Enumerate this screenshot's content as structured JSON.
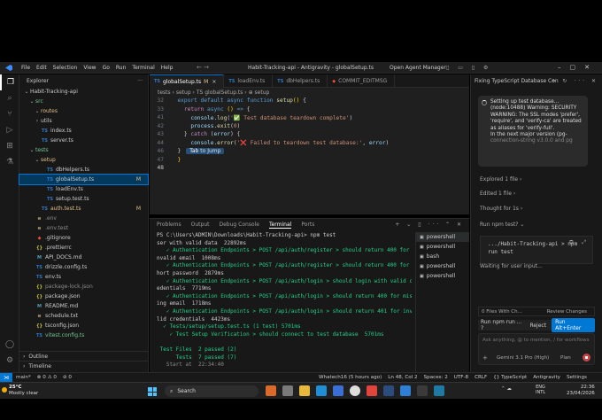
{
  "titlebar": {
    "menus": [
      "File",
      "Edit",
      "Selection",
      "View",
      "Go",
      "Run",
      "Terminal",
      "Help"
    ],
    "window_title": "Habit-Tracking-api - Antigravity - globalSetup.ts",
    "agent_manager": "Open Agent Manager"
  },
  "sidebar": {
    "header": "Explorer",
    "tree": [
      {
        "label": "Habit-Tracking-api",
        "chev": "⌄",
        "indent": 0,
        "icon": "",
        "status": "",
        "style": ""
      },
      {
        "label": "src",
        "chev": "⌄",
        "indent": 1,
        "icon": "",
        "status": "",
        "style": "git"
      },
      {
        "label": "routes",
        "chev": "⌄",
        "indent": 2,
        "icon": "",
        "status": "",
        "style": "mod"
      },
      {
        "label": "utils",
        "chev": "›",
        "indent": 2,
        "icon": "",
        "status": "",
        "style": ""
      },
      {
        "label": "index.ts",
        "chev": "",
        "indent": 2,
        "icon": "TS",
        "status": "",
        "style": ""
      },
      {
        "label": "server.ts",
        "chev": "",
        "indent": 2,
        "icon": "TS",
        "status": "",
        "style": ""
      },
      {
        "label": "tests",
        "chev": "⌄",
        "indent": 1,
        "icon": "",
        "status": "",
        "style": "git"
      },
      {
        "label": "setup",
        "chev": "⌄",
        "indent": 2,
        "icon": "",
        "status": "",
        "style": "mod"
      },
      {
        "label": "dbHelpers.ts",
        "chev": "",
        "indent": 3,
        "icon": "TS",
        "status": "",
        "style": ""
      },
      {
        "label": "globalSetup.ts",
        "chev": "",
        "indent": 3,
        "icon": "TS",
        "status": "M",
        "style": "selected"
      },
      {
        "label": "loadEnv.ts",
        "chev": "",
        "indent": 3,
        "icon": "TS",
        "status": "",
        "style": ""
      },
      {
        "label": "setup.test.ts",
        "chev": "",
        "indent": 3,
        "icon": "TS",
        "status": "",
        "style": ""
      },
      {
        "label": "auth.test.ts",
        "chev": "",
        "indent": 2,
        "icon": "TS",
        "status": "M",
        "style": "mod"
      },
      {
        "label": ".env",
        "chev": "",
        "indent": 1,
        "icon": "≡",
        "status": "",
        "style": "dim"
      },
      {
        "label": ".env.test",
        "chev": "",
        "indent": 1,
        "icon": "≡",
        "status": "",
        "style": "dim"
      },
      {
        "label": ".gitignore",
        "chev": "",
        "indent": 1,
        "icon": "◆",
        "status": "",
        "style": ""
      },
      {
        "label": ".prettierrc",
        "chev": "",
        "indent": 1,
        "icon": "{}",
        "status": "",
        "style": ""
      },
      {
        "label": "API_DOCS.md",
        "chev": "",
        "indent": 1,
        "icon": "M",
        "status": "",
        "style": ""
      },
      {
        "label": "drizzle.config.ts",
        "chev": "",
        "indent": 1,
        "icon": "TS",
        "status": "",
        "style": ""
      },
      {
        "label": "env.ts",
        "chev": "",
        "indent": 1,
        "icon": "TS",
        "status": "",
        "style": ""
      },
      {
        "label": "package-lock.json",
        "chev": "",
        "indent": 1,
        "icon": "{}",
        "status": "",
        "style": "dim"
      },
      {
        "label": "package.json",
        "chev": "",
        "indent": 1,
        "icon": "{}",
        "status": "",
        "style": ""
      },
      {
        "label": "README.md",
        "chev": "",
        "indent": 1,
        "icon": "M",
        "status": "",
        "style": ""
      },
      {
        "label": "schedule.txt",
        "chev": "",
        "indent": 1,
        "icon": "≡",
        "status": "",
        "style": ""
      },
      {
        "label": "tsconfig.json",
        "chev": "",
        "indent": 1,
        "icon": "{}",
        "status": "",
        "style": ""
      },
      {
        "label": "vitest.config.ts",
        "chev": "",
        "indent": 1,
        "icon": "TS",
        "status": "",
        "style": "git"
      }
    ],
    "outline": "Outline",
    "timeline": "Timeline"
  },
  "editor": {
    "tabs": [
      {
        "label": "globalSetup.ts",
        "mark": "M",
        "active": true
      },
      {
        "label": "loadEnv.ts",
        "mark": "",
        "active": false
      },
      {
        "label": "dbHelpers.ts",
        "mark": "",
        "active": false
      },
      {
        "label": "COMMIT_EDITMSG",
        "mark": "",
        "active": false
      }
    ],
    "breadcrumb": "tests › setup › TS globalSetup.ts › ⊕ setup",
    "lines": [
      {
        "n": "32",
        "html": "  <span class='kw'>export</span> <span class='kw'>default</span> <span class='kw'>async</span> <span class='kw'>function</span> <span class='fn'>setup</span><span class='pun'>()</span> {"
      },
      {
        "n": "33",
        "html": "    <span class='kw2'>return</span> <span class='kw'>async</span> <span class='pun'>()</span> <span class='kw'>=&gt;</span> {"
      },
      {
        "n": "41",
        "html": "      <span class='var'>console</span>.<span class='fn'>log</span>(<span class='str'>'✅ Test database teardown complete'</span>)"
      },
      {
        "n": "42",
        "html": "      <span class='var'>process</span>.<span class='fn'>exit</span>(<span class='str'>0</span>)"
      },
      {
        "n": "43",
        "html": "    } <span class='kw2'>catch</span> (<span class='var'>error</span>) {"
      },
      {
        "n": "44",
        "html": "      <span class='var'>console</span>.<span class='fn'>error</span>(<span class='str'>'❌ Failed to teardown test database:'</span>, <span class='var'>error</span>)"
      },
      {
        "n": "46",
        "html": "  }"
      },
      {
        "n": "47",
        "html": "  <span class='pun'>}</span>"
      },
      {
        "n": "48",
        "html": ""
      }
    ],
    "tab_to_jump_key": "Tab",
    "tab_to_jump": "to Jump"
  },
  "panel": {
    "tabs": [
      "Problems",
      "Output",
      "Debug Console",
      "Terminal",
      "Ports"
    ],
    "active_tab": "Terminal",
    "terminal_lines": [
      "PS C:\\Users\\ADMIN\\Downloads\\Habit-Tracking-api> npm test",
      "ser with valid data  22892ms",
      "   ✓ Authentication Endpoints > POST /api/auth/register > should return 400 for i",
      "nvalid email  1008ms",
      "   ✓ Authentication Endpoints > POST /api/auth/register > should return 400 for s",
      "hort password  2879ms",
      "   ✓ Authentication Endpoints > POST /api/auth/login > should login with valid cr",
      "edentials  7719ms",
      "   ✓ Authentication Endpoints > POST /api/auth/login > should return 400 for miss",
      "ing email  1718ms",
      "   ✓ Authentication Endpoints > POST /api/auth/login > should return 401 for inva",
      "lid credentials  4423ms",
      "  ✓ Tests/setup/setup.test.ts (1 test) 5701ms",
      "    ✓ Test Setup Verification > should connect to test database  5701ms",
      "",
      " Test Files  2 passed (2)",
      "      Tests  7 passed (7)",
      "   Start at  22:34:40"
    ],
    "terminal_list": [
      "powershell",
      "powershell",
      "bash",
      "powershell",
      "powershell"
    ]
  },
  "chat": {
    "title": "Fixing TypeScript Database Con",
    "message_lines": [
      "Setting up test database...",
      "(node:10488) Warning: SECURITY",
      "WARNING: The SSL modes 'prefer',",
      "'require', and 'verify-ca' are treated",
      "as aliases for 'verify-full'.",
      "In the next major version (pg-",
      "connection-string v3.0.0 and pg"
    ],
    "explored": "Explored 1 file",
    "edited": "Edited 1 file",
    "thought": "Thought for 1s",
    "run_command": "Run npm test?",
    "cmd_line1": ".../Habit-Tracking-api > npm",
    "cmd_line2": "run test",
    "waiting": "Waiting for user input...",
    "files_bar": "0 Files With Ch...",
    "review_changes": "Review Changes",
    "run_question": "Run npm run ... ?",
    "reject": "Reject",
    "run_btn": "Run Alt+Enter",
    "input_placeholder": "Ask anything, @ to mention, / for workflows",
    "model": "Gemini 3.1 Pro (High)",
    "plan": "Plan"
  },
  "statusbar": {
    "left": [
      "main*",
      "⊗ 0 ⚠ 0",
      "⊘ 0"
    ],
    "right": [
      "Whatech16 (5 hours ago)",
      "Ln 48, Col 2",
      "Spaces: 2",
      "UTF-8",
      "CRLF",
      "{} TypeScript",
      "Antigravity",
      "Settings"
    ]
  },
  "taskbar": {
    "temp": "25°C",
    "condition": "Mostly clear",
    "search": "Search",
    "lang1": "ENG",
    "lang2": "INTL",
    "time": "22:36",
    "date": "23/04/2026"
  },
  "colors": {
    "accent": "#0078d4",
    "bg_editor": "#1f1f1f",
    "bg_side": "#181818",
    "modified": "#e2c08d",
    "git_added": "#73c991",
    "term_ok": "#23d18b"
  }
}
